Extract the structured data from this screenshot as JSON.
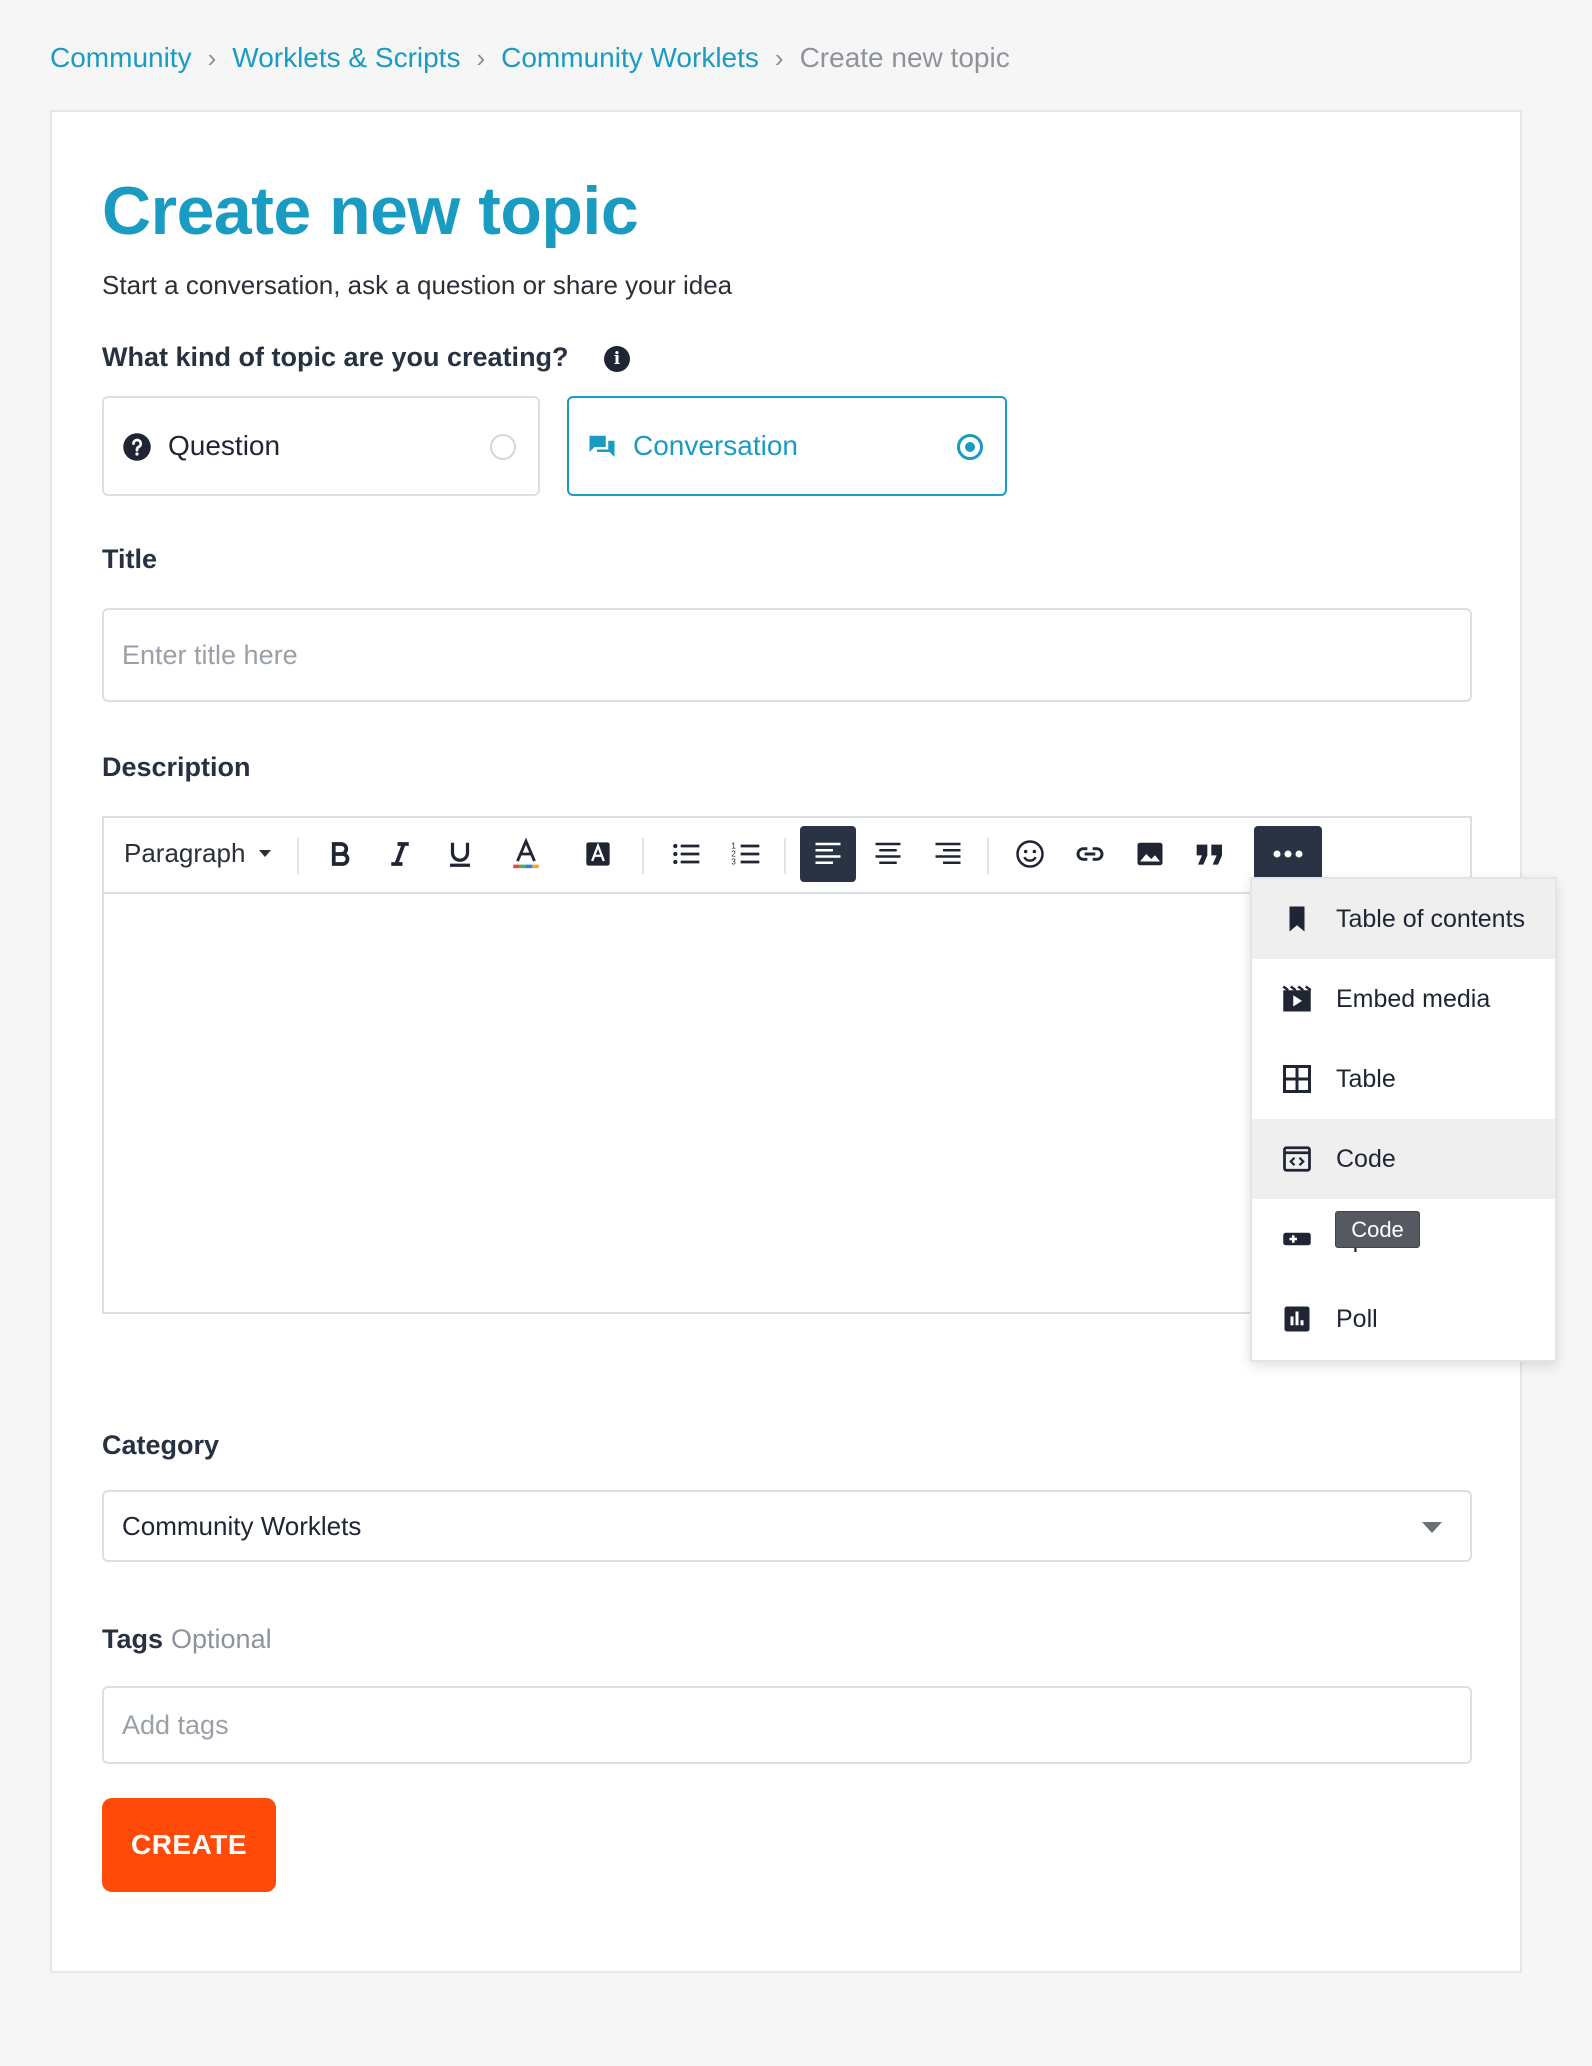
{
  "breadcrumb": {
    "items": [
      "Community",
      "Worklets & Scripts",
      "Community Worklets"
    ],
    "current": "Create new topic",
    "separator": "›"
  },
  "header": {
    "title": "Create new topic",
    "subtitle": "Start a conversation, ask a question or share your idea"
  },
  "topic_type": {
    "label": "What kind of topic are you creating?",
    "info_icon": "info-icon",
    "options": [
      {
        "label": "Question",
        "icon": "question-circle-icon",
        "selected": false
      },
      {
        "label": "Conversation",
        "icon": "chat-bubbles-icon",
        "selected": true
      }
    ]
  },
  "title_field": {
    "label": "Title",
    "placeholder": "Enter title here",
    "value": ""
  },
  "description": {
    "label": "Description",
    "toolbar": {
      "format_select": "Paragraph",
      "buttons": [
        "bold-icon",
        "italic-icon",
        "underline-icon",
        "text-color-icon",
        "highlight-icon",
        "bulleted-list-icon",
        "numbered-list-icon",
        "align-left-icon",
        "align-center-icon",
        "align-right-icon",
        "emoji-icon",
        "link-icon",
        "image-icon",
        "quote-icon",
        "more-icon"
      ],
      "active": "align-left-icon",
      "more_open": true
    },
    "more_menu": {
      "items": [
        {
          "label": "Table of contents",
          "icon": "bookmark-icon"
        },
        {
          "label": "Embed media",
          "icon": "embed-media-icon"
        },
        {
          "label": "Table",
          "icon": "table-icon"
        },
        {
          "label": "Code",
          "icon": "code-icon"
        },
        {
          "label": "Spoiler",
          "icon": "spoiler-icon"
        },
        {
          "label": "Poll",
          "icon": "poll-icon"
        }
      ],
      "hovered": "Code"
    },
    "tooltip": "Code"
  },
  "category": {
    "label": "Category",
    "selected": "Community Worklets"
  },
  "tags": {
    "label": "Tags",
    "optional_label": "Optional",
    "placeholder": "Add tags"
  },
  "actions": {
    "create_label": "CREATE"
  },
  "colors": {
    "accent": "#1a9bc1",
    "cta": "#ff4a0a",
    "toolbar_active": "#2a3344",
    "text_dark": "#1f2533"
  }
}
